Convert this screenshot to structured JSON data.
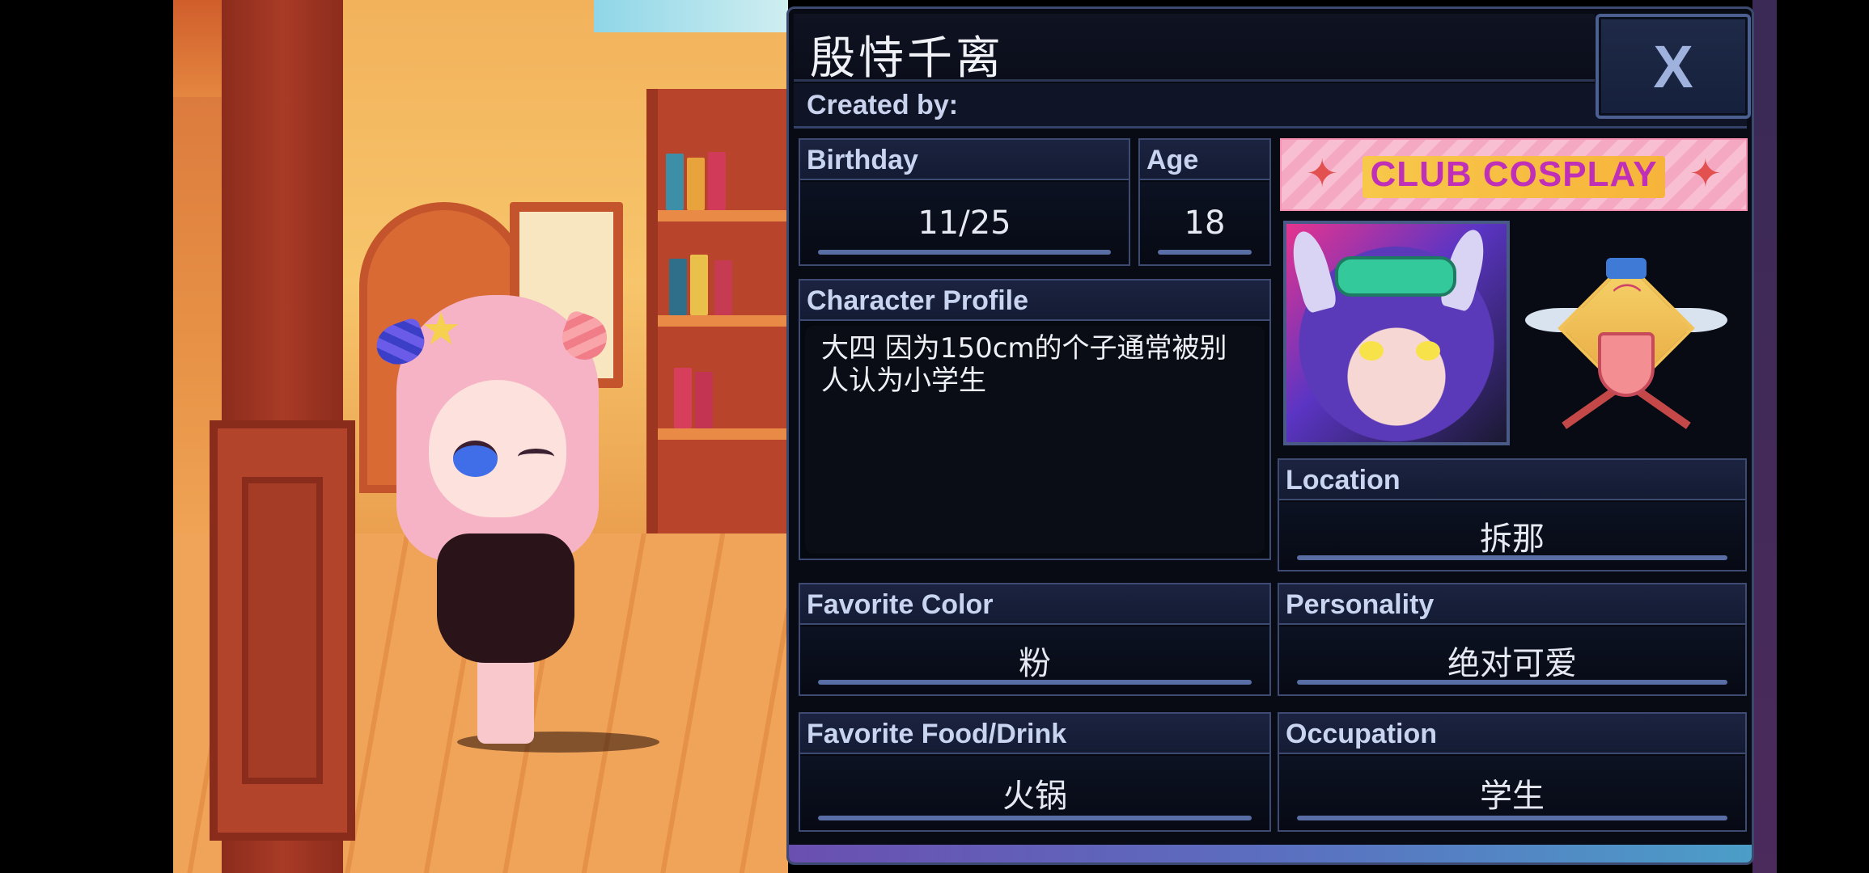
{
  "profile": {
    "name": "殷恃千离",
    "created_by_label": "Created by:",
    "close_label": "X",
    "banner_text": "CLUB COSPLAY",
    "fields": {
      "birthday": {
        "label": "Birthday",
        "value": "11/25"
      },
      "age": {
        "label": "Age",
        "value": "18"
      },
      "character_profile": {
        "label": "Character Profile",
        "value": "大四 因为150cm的个子通常被别人认为小学生"
      },
      "location": {
        "label": "Location",
        "value": "拆那"
      },
      "favorite_color": {
        "label": "Favorite Color",
        "value": "粉"
      },
      "personality": {
        "label": "Personality",
        "value": "绝对可爱"
      },
      "favorite_food": {
        "label": "Favorite Food/Drink",
        "value": "火锅"
      },
      "occupation": {
        "label": "Occupation",
        "value": "学生"
      }
    }
  },
  "colors": {
    "panel_bg": "#080a14",
    "field_border": "#3d4b72",
    "label_bg": "#1b2340",
    "underline": "#5a6ea6",
    "banner_text": "#c02fb8"
  },
  "icons": {
    "close": "close-icon",
    "emblem": "club-emblem-icon",
    "star": "star-icon"
  }
}
